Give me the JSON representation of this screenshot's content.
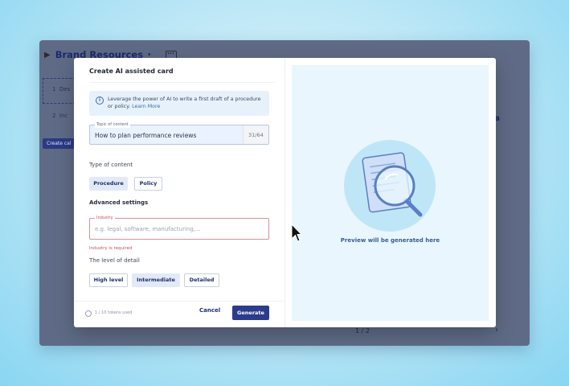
{
  "background_app": {
    "title": "Brand Resources",
    "more_glyph": "···",
    "list_rows": [
      {
        "number": "1",
        "text": "Des"
      },
      {
        "number": "2",
        "text": "Inc"
      }
    ],
    "create_button": "Create cal",
    "right_letter": "a",
    "pager": "1 / 2",
    "next_glyph": "›"
  },
  "modal": {
    "title": "Create AI assisted card",
    "info": {
      "text": "Leverage the power of AI to write a first draft of a procedure or policy.",
      "link": "Learn More"
    },
    "topic": {
      "label": "Topic of content",
      "value": "How to plan performance reviews",
      "counter": "31/64"
    },
    "type_of_content": {
      "label": "Type of content",
      "options": [
        "Procedure",
        "Policy"
      ],
      "selected": "Procedure"
    },
    "advanced_settings_label": "Advanced settings",
    "industry": {
      "label": "Industry",
      "placeholder": "e.g. legal, software, manufacturing,...",
      "error": "Industry is required"
    },
    "level_of_detail": {
      "label": "The level of detail",
      "options": [
        "High level",
        "Intermediate",
        "Detailed"
      ],
      "selected": "Intermediate"
    },
    "footer": {
      "tokens": "1 / 10 tokens used",
      "cancel": "Cancel",
      "generate": "Generate"
    },
    "preview": {
      "text": "Preview will be generated here"
    }
  },
  "colors": {
    "primary": "#2c3c8c",
    "error": "#c0505f",
    "preview_bg": "#e9f6fd",
    "info_bg": "#e6f1fb"
  }
}
